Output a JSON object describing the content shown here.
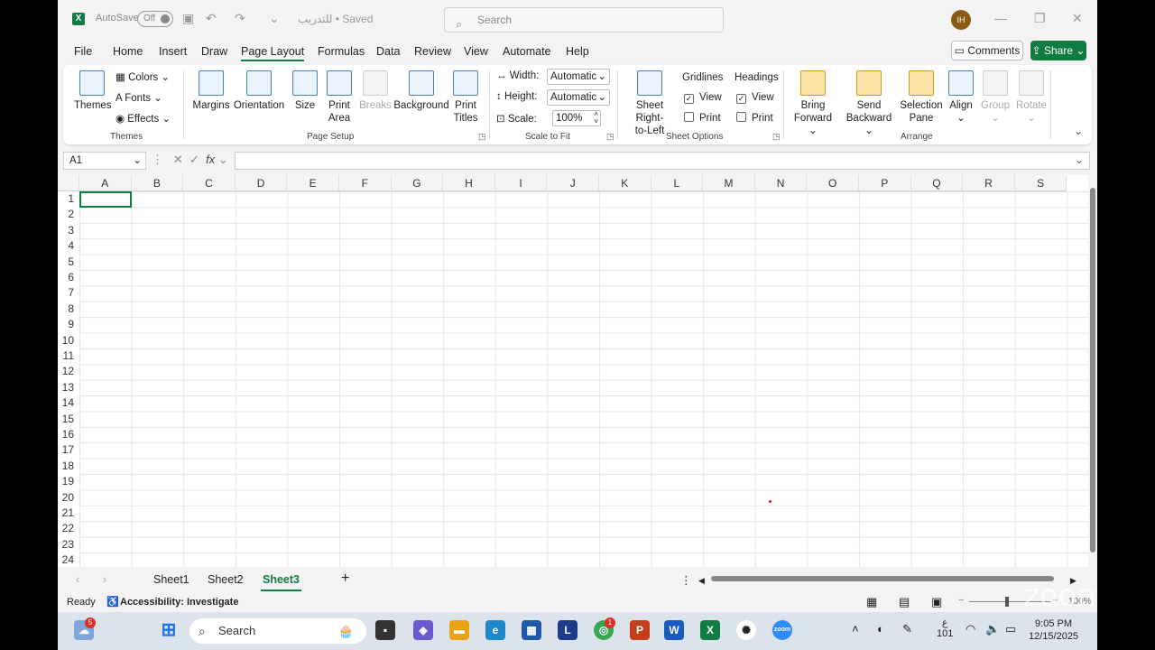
{
  "titlebar": {
    "autosave_label": "AutoSave",
    "autosave_state": "Off",
    "doc_title": "للتدريب • Saved",
    "search_placeholder": "Search",
    "avatar_initials": "IH"
  },
  "menu": {
    "tabs": [
      "File",
      "Home",
      "Insert",
      "Draw",
      "Page Layout",
      "Formulas",
      "Data",
      "Review",
      "View",
      "Automate",
      "Help"
    ],
    "active_tab": "Page Layout",
    "comments_label": "Comments",
    "share_label": "Share"
  },
  "ribbon": {
    "themes_group": {
      "label": "Themes",
      "themes": "Themes",
      "colors": "Colors",
      "fonts": "Fonts",
      "effects": "Effects"
    },
    "page_setup": {
      "label": "Page Setup",
      "margins": "Margins",
      "orientation": "Orientation",
      "size": "Size",
      "print_area_1": "Print",
      "print_area_2": "Area",
      "breaks": "Breaks",
      "background": "Background",
      "print_titles_1": "Print",
      "print_titles_2": "Titles"
    },
    "scale_to_fit": {
      "label": "Scale to Fit",
      "width_label": "Width:",
      "width_value": "Automatic",
      "height_label": "Height:",
      "height_value": "Automatic",
      "scale_label": "Scale:",
      "scale_value": "100%"
    },
    "sheet_options": {
      "label": "Sheet Options",
      "sheet_rtl_1": "Sheet Right-",
      "sheet_rtl_2": "to-Left",
      "gridlines": "Gridlines",
      "headings": "Headings",
      "view": "View",
      "print": "Print"
    },
    "arrange": {
      "label": "Arrange",
      "bring_forward_1": "Bring",
      "bring_forward_2": "Forward",
      "send_backward_1": "Send",
      "send_backward_2": "Backward",
      "selection_pane_1": "Selection",
      "selection_pane_2": "Pane",
      "align": "Align",
      "group": "Group",
      "rotate": "Rotate"
    }
  },
  "formula_bar": {
    "name_box": "A1",
    "fx": "fx",
    "formula": ""
  },
  "grid": {
    "columns": [
      "A",
      "B",
      "C",
      "D",
      "E",
      "F",
      "G",
      "H",
      "I",
      "J",
      "K",
      "L",
      "M",
      "N",
      "O",
      "P",
      "Q",
      "R",
      "S"
    ],
    "rows": [
      "1",
      "2",
      "3",
      "4",
      "5",
      "6",
      "7",
      "8",
      "9",
      "10",
      "11",
      "12",
      "13",
      "14",
      "15",
      "16",
      "17",
      "18",
      "19",
      "20",
      "21",
      "22",
      "23",
      "24"
    ]
  },
  "sheets": {
    "tabs": [
      "Sheet1",
      "Sheet2",
      "Sheet3"
    ],
    "active": "Sheet3",
    "add": "+"
  },
  "status": {
    "ready": "Ready",
    "accessibility": "Accessibility: Investigate",
    "zoom": "100%"
  },
  "taskbar": {
    "search_placeholder": "Search",
    "weather_badge": "5",
    "chrome_badge": "1",
    "lang": "ع",
    "lang_sub": "101",
    "time": "9:05 PM",
    "date": "12/15/2025"
  },
  "watermark": "zoom",
  "colors": {
    "excel_green": "#107c41",
    "share_bg": "#107c41"
  }
}
